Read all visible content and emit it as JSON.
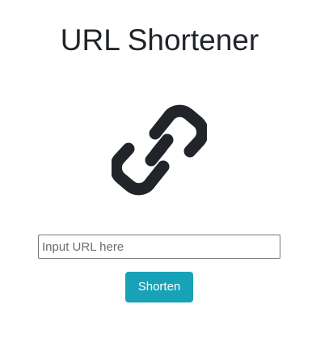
{
  "header": {
    "title": "URL Shortener"
  },
  "logo": {
    "icon": "link-icon",
    "color": "#212529"
  },
  "form": {
    "url_input": {
      "value": "",
      "placeholder": "Input URL here"
    },
    "shorten_label": "Shorten",
    "button_color": "#17a2b8"
  }
}
